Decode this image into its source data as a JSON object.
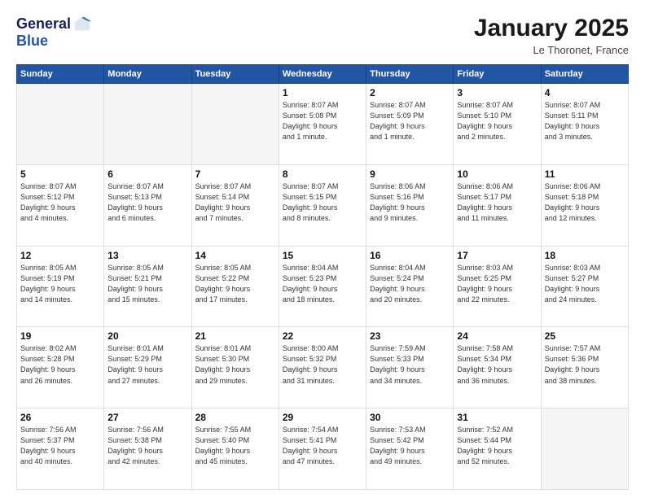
{
  "header": {
    "logo": {
      "general": "General",
      "blue": "Blue"
    },
    "title": "January 2025",
    "location": "Le Thoronet, France"
  },
  "calendar": {
    "weekdays": [
      "Sunday",
      "Monday",
      "Tuesday",
      "Wednesday",
      "Thursday",
      "Friday",
      "Saturday"
    ],
    "weeks": [
      [
        {
          "day": "",
          "info": ""
        },
        {
          "day": "",
          "info": ""
        },
        {
          "day": "",
          "info": ""
        },
        {
          "day": "1",
          "info": "Sunrise: 8:07 AM\nSunset: 5:08 PM\nDaylight: 9 hours\nand 1 minute."
        },
        {
          "day": "2",
          "info": "Sunrise: 8:07 AM\nSunset: 5:09 PM\nDaylight: 9 hours\nand 1 minute."
        },
        {
          "day": "3",
          "info": "Sunrise: 8:07 AM\nSunset: 5:10 PM\nDaylight: 9 hours\nand 2 minutes."
        },
        {
          "day": "4",
          "info": "Sunrise: 8:07 AM\nSunset: 5:11 PM\nDaylight: 9 hours\nand 3 minutes."
        }
      ],
      [
        {
          "day": "5",
          "info": "Sunrise: 8:07 AM\nSunset: 5:12 PM\nDaylight: 9 hours\nand 4 minutes."
        },
        {
          "day": "6",
          "info": "Sunrise: 8:07 AM\nSunset: 5:13 PM\nDaylight: 9 hours\nand 6 minutes."
        },
        {
          "day": "7",
          "info": "Sunrise: 8:07 AM\nSunset: 5:14 PM\nDaylight: 9 hours\nand 7 minutes."
        },
        {
          "day": "8",
          "info": "Sunrise: 8:07 AM\nSunset: 5:15 PM\nDaylight: 9 hours\nand 8 minutes."
        },
        {
          "day": "9",
          "info": "Sunrise: 8:06 AM\nSunset: 5:16 PM\nDaylight: 9 hours\nand 9 minutes."
        },
        {
          "day": "10",
          "info": "Sunrise: 8:06 AM\nSunset: 5:17 PM\nDaylight: 9 hours\nand 11 minutes."
        },
        {
          "day": "11",
          "info": "Sunrise: 8:06 AM\nSunset: 5:18 PM\nDaylight: 9 hours\nand 12 minutes."
        }
      ],
      [
        {
          "day": "12",
          "info": "Sunrise: 8:05 AM\nSunset: 5:19 PM\nDaylight: 9 hours\nand 14 minutes."
        },
        {
          "day": "13",
          "info": "Sunrise: 8:05 AM\nSunset: 5:21 PM\nDaylight: 9 hours\nand 15 minutes."
        },
        {
          "day": "14",
          "info": "Sunrise: 8:05 AM\nSunset: 5:22 PM\nDaylight: 9 hours\nand 17 minutes."
        },
        {
          "day": "15",
          "info": "Sunrise: 8:04 AM\nSunset: 5:23 PM\nDaylight: 9 hours\nand 18 minutes."
        },
        {
          "day": "16",
          "info": "Sunrise: 8:04 AM\nSunset: 5:24 PM\nDaylight: 9 hours\nand 20 minutes."
        },
        {
          "day": "17",
          "info": "Sunrise: 8:03 AM\nSunset: 5:25 PM\nDaylight: 9 hours\nand 22 minutes."
        },
        {
          "day": "18",
          "info": "Sunrise: 8:03 AM\nSunset: 5:27 PM\nDaylight: 9 hours\nand 24 minutes."
        }
      ],
      [
        {
          "day": "19",
          "info": "Sunrise: 8:02 AM\nSunset: 5:28 PM\nDaylight: 9 hours\nand 26 minutes."
        },
        {
          "day": "20",
          "info": "Sunrise: 8:01 AM\nSunset: 5:29 PM\nDaylight: 9 hours\nand 27 minutes."
        },
        {
          "day": "21",
          "info": "Sunrise: 8:01 AM\nSunset: 5:30 PM\nDaylight: 9 hours\nand 29 minutes."
        },
        {
          "day": "22",
          "info": "Sunrise: 8:00 AM\nSunset: 5:32 PM\nDaylight: 9 hours\nand 31 minutes."
        },
        {
          "day": "23",
          "info": "Sunrise: 7:59 AM\nSunset: 5:33 PM\nDaylight: 9 hours\nand 34 minutes."
        },
        {
          "day": "24",
          "info": "Sunrise: 7:58 AM\nSunset: 5:34 PM\nDaylight: 9 hours\nand 36 minutes."
        },
        {
          "day": "25",
          "info": "Sunrise: 7:57 AM\nSunset: 5:36 PM\nDaylight: 9 hours\nand 38 minutes."
        }
      ],
      [
        {
          "day": "26",
          "info": "Sunrise: 7:56 AM\nSunset: 5:37 PM\nDaylight: 9 hours\nand 40 minutes."
        },
        {
          "day": "27",
          "info": "Sunrise: 7:56 AM\nSunset: 5:38 PM\nDaylight: 9 hours\nand 42 minutes."
        },
        {
          "day": "28",
          "info": "Sunrise: 7:55 AM\nSunset: 5:40 PM\nDaylight: 9 hours\nand 45 minutes."
        },
        {
          "day": "29",
          "info": "Sunrise: 7:54 AM\nSunset: 5:41 PM\nDaylight: 9 hours\nand 47 minutes."
        },
        {
          "day": "30",
          "info": "Sunrise: 7:53 AM\nSunset: 5:42 PM\nDaylight: 9 hours\nand 49 minutes."
        },
        {
          "day": "31",
          "info": "Sunrise: 7:52 AM\nSunset: 5:44 PM\nDaylight: 9 hours\nand 52 minutes."
        },
        {
          "day": "",
          "info": ""
        }
      ]
    ]
  }
}
